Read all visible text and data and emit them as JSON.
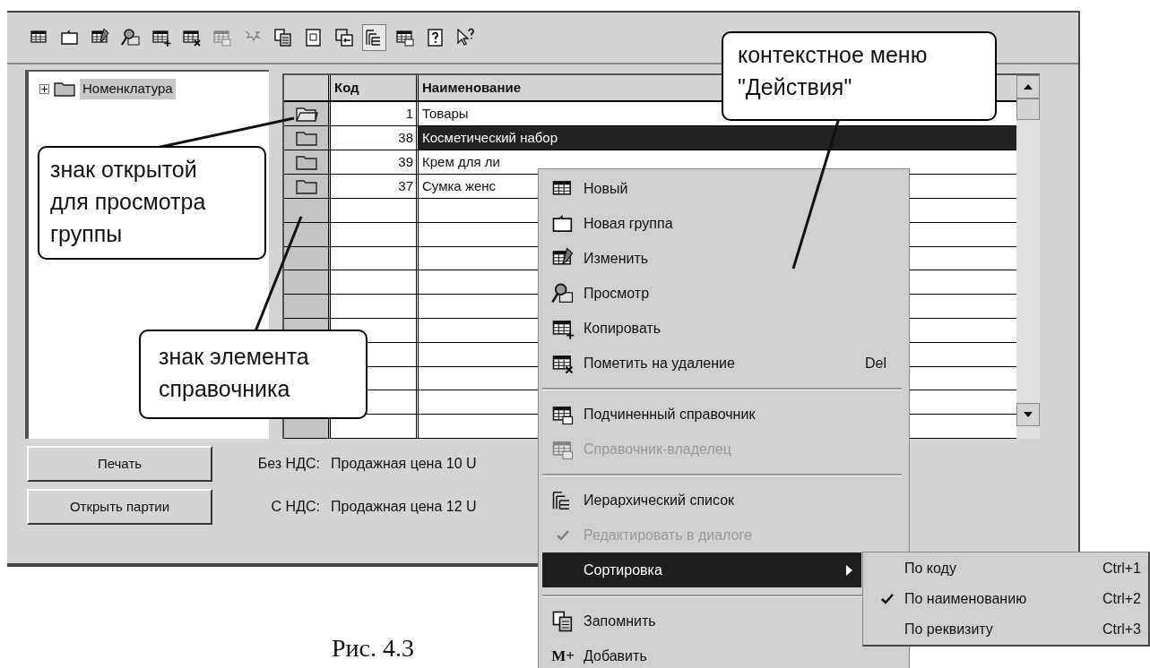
{
  "toolbar": {
    "buttons": [
      {
        "disabled": false,
        "pressed": false
      },
      {
        "disabled": false,
        "pressed": false
      },
      {
        "disabled": false,
        "pressed": false
      },
      {
        "disabled": false,
        "pressed": false
      },
      {
        "disabled": false,
        "pressed": false
      },
      {
        "disabled": false,
        "pressed": false
      },
      {
        "disabled": true,
        "pressed": false
      },
      {
        "disabled": true,
        "pressed": false
      },
      {
        "disabled": false,
        "pressed": false
      },
      {
        "disabled": false,
        "pressed": false
      },
      {
        "disabled": false,
        "pressed": false
      },
      {
        "disabled": false,
        "pressed": true
      },
      {
        "disabled": false,
        "pressed": false
      },
      {
        "disabled": false,
        "pressed": false
      },
      {
        "disabled": false,
        "pressed": false
      }
    ]
  },
  "tree": {
    "items": [
      {
        "label": "Номенклатура",
        "expanded": false,
        "selected": true
      }
    ]
  },
  "table": {
    "columns": [
      "Код",
      "Наименование"
    ],
    "rows": [
      {
        "open": true,
        "code": "1",
        "name": "Товары",
        "selected": false
      },
      {
        "open": false,
        "code": "38",
        "name": "Косметический набор",
        "selected": true
      },
      {
        "open": false,
        "code": "39",
        "name": "Крем для ли",
        "selected": false
      },
      {
        "open": false,
        "code": "37",
        "name": "Сумка женс",
        "selected": false
      }
    ]
  },
  "buttons": [
    {
      "label": "Печать"
    },
    {
      "label": "Открыть партии"
    }
  ],
  "prices": [
    {
      "label": "Без НДС:",
      "value": "Продажная цена 10 U"
    },
    {
      "label": "С НДС:",
      "value": "Продажная цена 12 U"
    }
  ],
  "context_menu": {
    "items": [
      {
        "kind": "command",
        "label": "Новый",
        "disabled": false,
        "checked": false,
        "selected": false,
        "submenu": false
      },
      {
        "kind": "command",
        "label": "Новая группа",
        "disabled": false,
        "checked": false,
        "selected": false,
        "submenu": false
      },
      {
        "kind": "command",
        "label": "Изменить",
        "disabled": false,
        "checked": false,
        "selected": false,
        "submenu": false
      },
      {
        "kind": "command",
        "label": "Просмотр",
        "disabled": false,
        "checked": false,
        "selected": false,
        "submenu": false
      },
      {
        "kind": "command",
        "label": "Копировать",
        "disabled": false,
        "checked": false,
        "selected": false,
        "submenu": false
      },
      {
        "kind": "command",
        "label": "Пометить на удаление",
        "shortcut": "Del",
        "disabled": false,
        "checked": false,
        "selected": false,
        "submenu": false
      },
      {
        "kind": "separator"
      },
      {
        "kind": "command",
        "label": "Подчиненный справочник",
        "disabled": false,
        "checked": false,
        "selected": false,
        "submenu": false
      },
      {
        "kind": "command",
        "label": "Справочник-владелец",
        "disabled": true,
        "checked": false,
        "selected": false,
        "submenu": false
      },
      {
        "kind": "separator"
      },
      {
        "kind": "command",
        "label": "Иерархический список",
        "disabled": false,
        "checked": false,
        "selected": false,
        "submenu": false
      },
      {
        "kind": "command",
        "label": "Редактировать в диалоге",
        "disabled": true,
        "checked": true,
        "selected": false,
        "submenu": false
      },
      {
        "kind": "command",
        "label": "Сортировка",
        "disabled": false,
        "checked": false,
        "selected": true,
        "submenu": true
      },
      {
        "kind": "separator"
      },
      {
        "kind": "command",
        "label": "Запомнить",
        "disabled": false,
        "checked": false,
        "selected": false,
        "submenu": false
      },
      {
        "kind": "command",
        "label": "Добавить",
        "glyph": "M+",
        "disabled": false,
        "checked": false,
        "selected": false,
        "submenu": false
      }
    ]
  },
  "submenu": {
    "items": [
      {
        "label": "По коду",
        "shortcut": "Ctrl+1",
        "checked": false
      },
      {
        "label": "По наименованию",
        "shortcut": "Ctrl+2",
        "checked": true
      },
      {
        "label": "По реквизиту",
        "shortcut": "Ctrl+3",
        "checked": false
      }
    ]
  },
  "callouts": [
    {
      "text": "контекстное меню \"Действия\""
    },
    {
      "text": "знак открытой для просмотра группы"
    },
    {
      "text": "знак элемента справочника"
    }
  ],
  "caption": "Рис. 4.3"
}
